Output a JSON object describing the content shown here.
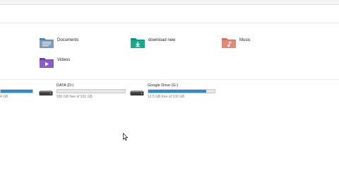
{
  "folders": [
    {
      "label": "Documents",
      "icon": "documents-folder-icon"
    },
    {
      "label": "download new",
      "icon": "download-folder-icon"
    },
    {
      "label": "Music",
      "icon": "music-folder-icon"
    },
    {
      "label": "Videos",
      "icon": "videos-folder-icon"
    }
  ],
  "drives": [
    {
      "name": "",
      "free_text": "4 GB",
      "used_fraction": 1.0
    },
    {
      "name": "DATA (D:)",
      "free_text": "930 GB free of 931 GB",
      "used_fraction": 0.0
    },
    {
      "name": "Google Drive (G:)",
      "free_text": "12.5 GB free of 100 GB",
      "used_fraction": 0.875
    }
  ],
  "colors": {
    "drive_fill": "#2a8ad4",
    "bar_bg": "#e6e6e6"
  }
}
